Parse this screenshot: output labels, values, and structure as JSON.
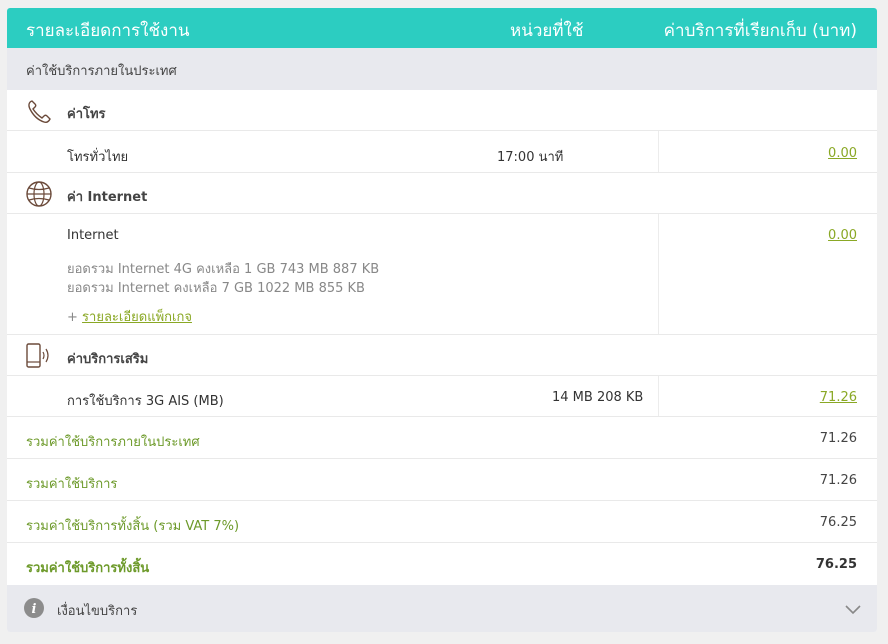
{
  "header": {
    "detail": "รายละเอียดการใช้งาน",
    "unit": "หน่วยที่ใช้",
    "charge": "ค่าบริการที่เรียกเก็บ (บาท)"
  },
  "section": {
    "title": "ค่าใช้บริการภายในประเทศ"
  },
  "voice": {
    "category": "ค่าโทร",
    "icon": "phone-icon",
    "item_label": "โทรทั่วไทย",
    "item_unit": "17:00 นาที",
    "item_amount": "0.00"
  },
  "internet": {
    "category": "ค่า Internet",
    "icon": "globe-icon",
    "item_label": "Internet",
    "item_amount": "0.00",
    "note1": "ยอดรวม Internet 4G คงเหลือ 1 GB 743 MB 887 KB",
    "note2": "ยอดรวม Internet คงเหลือ 7 GB 1022 MB 855 KB",
    "plus": "+",
    "package_link": "รายละเอียดแพ็กเกจ"
  },
  "addon": {
    "category": "ค่าบริการเสริม",
    "icon": "mobile-signal-icon",
    "item_label": "การใช้บริการ 3G AIS (MB)",
    "item_unit": "14 MB 208 KB",
    "item_amount": "71.26"
  },
  "summary": [
    {
      "label": "รวมค่าใช้บริการภายในประเทศ",
      "value": "71.26"
    },
    {
      "label": "รวมค่าใช้บริการ",
      "value": "71.26"
    },
    {
      "label": "รวมค่าใช้บริการทั้งสิ้น (รวม VAT 7%)",
      "value": "76.25"
    },
    {
      "label": "รวมค่าใช้บริการทั้งสิ้น",
      "value": "76.25"
    }
  ],
  "footer": {
    "label": "เงื่อนไขบริการ",
    "icon": "info-icon",
    "toggle_icon": "chevron-down-icon"
  },
  "colors": {
    "header_bg": "#2ccdc1",
    "accent_green": "#8aa825",
    "summary_green": "#6d9a2a",
    "bar_gray": "#e8e9ee",
    "icon_brown": "#6b4a3a"
  }
}
